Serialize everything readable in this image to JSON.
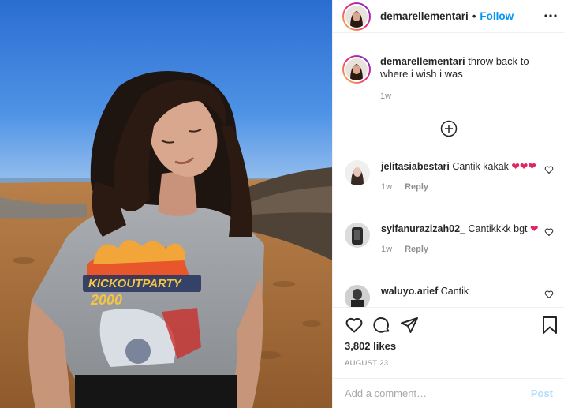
{
  "post": {
    "author": {
      "username": "demarellementari",
      "separator": "•",
      "follow_label": "Follow"
    },
    "caption": {
      "username": "demarellementari",
      "text": "throw back to where i wish i was",
      "time": "1w"
    },
    "load_more_icon": "plus-circle-icon",
    "comments": [
      {
        "username": "jelitasiabestari",
        "text": "Cantik kakak",
        "emoji": "❤❤❤",
        "time": "1w",
        "reply_label": "Reply"
      },
      {
        "username": "syifanurazizah02_",
        "text": "Cantikkkk bgt",
        "emoji": "❤",
        "time": "1w",
        "reply_label": "Reply"
      },
      {
        "username": "waluyo.arief",
        "text": "Cantik"
      }
    ],
    "likes": "3,802 likes",
    "date": "AUGUST 23",
    "comment_input": {
      "placeholder": "Add a comment…",
      "post_label": "Post"
    },
    "colors": {
      "accent": "#0095f6",
      "heart": "#e0245e",
      "text": "#262626",
      "muted": "#8e8e8e"
    }
  }
}
